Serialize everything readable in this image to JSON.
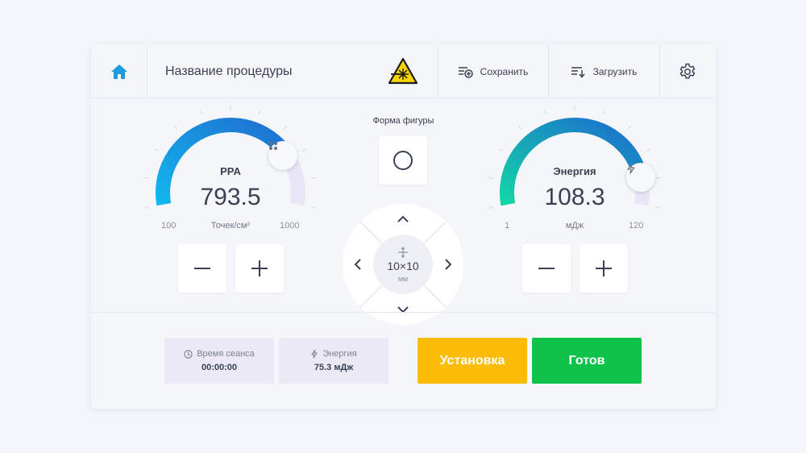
{
  "header": {
    "title": "Название процедуры",
    "save_label": "Сохранить",
    "load_label": "Загрузить"
  },
  "colors": {
    "accent_blue": "#1e9be0",
    "setup_button": "#fbbc05",
    "ready_button": "#0ec24a",
    "info_box_bg": "#ece9f6"
  },
  "gauge_left": {
    "label": "PPA",
    "value": "793.5",
    "unit": "Точек/см²",
    "min": "100",
    "max": "1000",
    "level": 0.77,
    "knob_icon": "dots-grid-icon"
  },
  "gauge_right": {
    "label": "Энергия",
    "value": "108.3",
    "unit": "мДж",
    "min": "1",
    "max": "120",
    "level": 0.9,
    "knob_icon": "lightning-icon"
  },
  "shape": {
    "label": "Форма фигуры",
    "icon": "circle-icon"
  },
  "size": {
    "value": "10×10",
    "unit": "мм"
  },
  "status": {
    "session_label": "Время сеанса",
    "session_value": "00:00:00",
    "energy_label": "Энергия",
    "energy_value": "75.3 мДж"
  },
  "actions": {
    "setup_label": "Установка",
    "ready_label": "Готов"
  }
}
